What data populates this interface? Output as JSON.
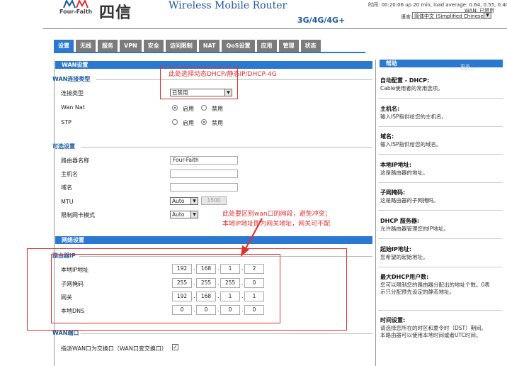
{
  "header": {
    "logo_text": "Four-Faith",
    "brand_cn": "四信",
    "product": "Wireless Mobile Router",
    "product_sub": "3G/4G/4G+",
    "status_line1": "时间: 00:20:06 up 20 min, load average: 0.64, 0.55, 0.40",
    "status_line2": "WAN: 已禁用",
    "language_label": "语言:",
    "language_value": "简体中文 (Simplified Chinese)"
  },
  "nav": {
    "tabs": [
      "设置",
      "无线",
      "服务",
      "VPN",
      "安全",
      "访问限制",
      "NAT",
      "QoS设置",
      "应用",
      "管理",
      "状态"
    ],
    "active": "设置"
  },
  "main": {
    "wan_section": "WAN设置",
    "wan_type_heading": "WAN连接类型",
    "conn_type_label": "连接类型",
    "conn_type_value": "已禁用",
    "wan_nat_label": "Wan Nat",
    "enable": "启用",
    "disable": "禁用",
    "stp_label": "STP",
    "optional_heading": "可选设置",
    "router_name_label": "路由器名称",
    "router_name_value": "Four-Faith",
    "hostname_label": "主机名",
    "domain_label": "域名",
    "mtu_label": "MTU",
    "mtu_mode": "Auto",
    "mtu_value": "1500",
    "nic_mode_label": "限制网卡模式",
    "nic_mode_value": "Auto",
    "network_section": "网络设置",
    "router_ip_heading": "路由器IP",
    "local_ip_label": "本地IP地址",
    "local_ip": [
      "192",
      "168",
      "1",
      "2"
    ],
    "subnet_label": "子网掩码",
    "subnet": [
      "255",
      "255",
      "255",
      "0"
    ],
    "gateway_label": "网关",
    "gateway": [
      "192",
      "168",
      "1",
      "1"
    ],
    "dns_label": "本地DNS",
    "dns": [
      "0",
      "0",
      "0",
      "0"
    ],
    "wan_port_heading": "WAN端口",
    "wan_port_label": "指派WAN口为交换口（WAN口变交换口）"
  },
  "help": {
    "title": "帮助",
    "more": "更多...",
    "items": [
      {
        "title": "自动配置 - DHCP:",
        "text": "Cable使用者的常用选项。"
      },
      {
        "title": "主机名:",
        "text": "输入ISP指供给您的主机名。"
      },
      {
        "title": "域名:",
        "text": "输入ISP指供给您的域名。"
      },
      {
        "title": "本地IP地址:",
        "text": "这是路由器的地址。"
      },
      {
        "title": "子网掩码:",
        "text": "这是路由器的子网掩码。"
      },
      {
        "title": "DHCP 服务器:",
        "text": "允许路由器管理您的IP地址。"
      },
      {
        "title": "起始IP地址:",
        "text": "您希望的起始地址。"
      },
      {
        "title": "最大DHCP用户数:",
        "text": "您可以限制您的路由器分配出的地址个数。0表示只分配预先设定的静态地址。"
      },
      {
        "title": "时间设置:",
        "text": "请选择您所在的时区和夏令时（DST）期间。本路由器可以使用本地时间或者UTC时间。"
      }
    ]
  },
  "annotations": {
    "note1": "此处选择动态DHCP/静态IP/DHCP-4G",
    "note2_line1": "此处要区别wan口的网段，避免冲突；",
    "note2_line2": "本地IP地址即为网关地址，网关可不配"
  },
  "colors": {
    "accent": "#2a78d0",
    "tab_inactive": "#7b7b7b",
    "annotation": "#e23030",
    "brand": "#1a5aa0"
  }
}
